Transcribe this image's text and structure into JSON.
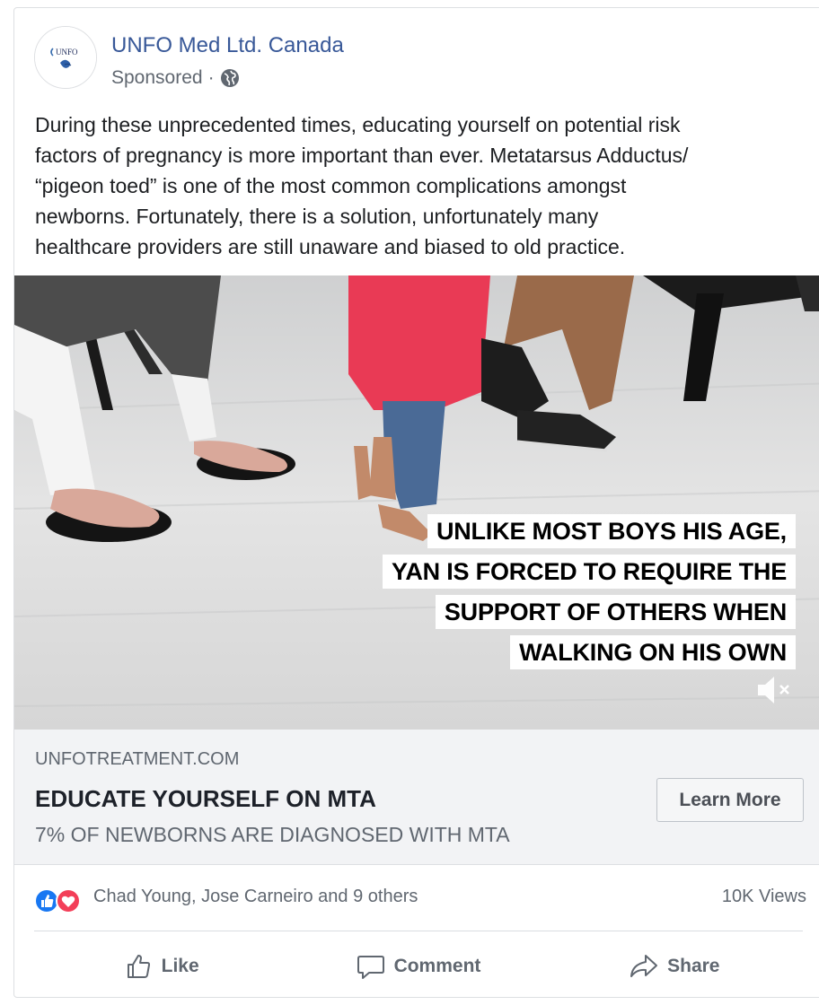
{
  "post": {
    "page_name": "UNFO Med Ltd. Canada",
    "sponsored": "Sponsored",
    "separator": "·",
    "avatar_text": "UNFO",
    "body": "During these unprecedented times, educating yourself on potential risk\nfactors of pregnancy is more important than ever. Metatarsus Adductus/\n“pigeon toed” is one of the most common complications amongst\nnewborns. Fortunately, there is a solution, unfortunately many\nhealthcare providers are still unaware and biased to old practice."
  },
  "video": {
    "caption_lines": [
      "UNLIKE MOST BOYS HIS AGE,",
      "YAN IS FORCED TO REQUIRE THE",
      "SUPPORT OF OTHERS WHEN",
      "WALKING ON HIS OWN"
    ],
    "muted": true
  },
  "link": {
    "domain": "UNFOTREATMENT.COM",
    "headline": "EDUCATE YOURSELF ON MTA",
    "description": "7% OF NEWBORNS ARE DIAGNOSED WITH MTA",
    "cta": "Learn More"
  },
  "stats": {
    "reactions_text": "Chad Young, Jose Carneiro and 9 others",
    "views": "10K Views"
  },
  "actions": {
    "like": "Like",
    "comment": "Comment",
    "share": "Share"
  },
  "colors": {
    "link_blue": "#385898",
    "like_blue": "#1877f2",
    "love_red": "#f33e58",
    "panel_gray": "#f2f3f5"
  }
}
